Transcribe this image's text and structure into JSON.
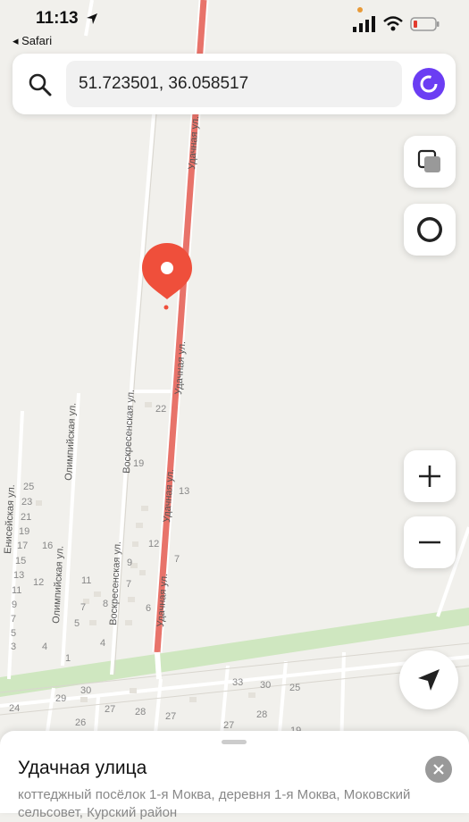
{
  "status_bar": {
    "time": "11:13",
    "back_label": "◂ Safari"
  },
  "search": {
    "query": "51.723501, 36.058517"
  },
  "map": {
    "street_labels": [
      "Удачная ул.",
      "Удачная ул.",
      "Удачная ул.",
      "Удачная ул.",
      "Воскресенская ул.",
      "Воскресенская ул.",
      "Олимпийская ул.",
      "Олимпийская ул.",
      "Енисейская ул."
    ],
    "house_numbers": [
      "22",
      "19",
      "13",
      "12",
      "7",
      "9",
      "7",
      "6",
      "8",
      "5",
      "4",
      "4",
      "1",
      "25",
      "23",
      "21",
      "19",
      "17",
      "16",
      "15",
      "13",
      "12",
      "11",
      "11",
      "9",
      "7",
      "7",
      "5",
      "3",
      "30",
      "29",
      "26",
      "24",
      "27",
      "28",
      "27",
      "33",
      "30",
      "28",
      "25",
      "27",
      "19"
    ],
    "colors": {
      "road_highlight": "#e8736a",
      "park": "#c8e6b8",
      "pin": "#ef4f3b"
    }
  },
  "controls": {
    "layers": "layers-icon",
    "alice": "alice-icon",
    "zoom_in": "+",
    "zoom_out": "−",
    "locate": "navigation-icon"
  },
  "place": {
    "title": "Удачная улица",
    "subtitle": "коттеджный посёлок 1-я Моква, деревня 1-я Моква, Моковский сельсовет, Курский район"
  }
}
